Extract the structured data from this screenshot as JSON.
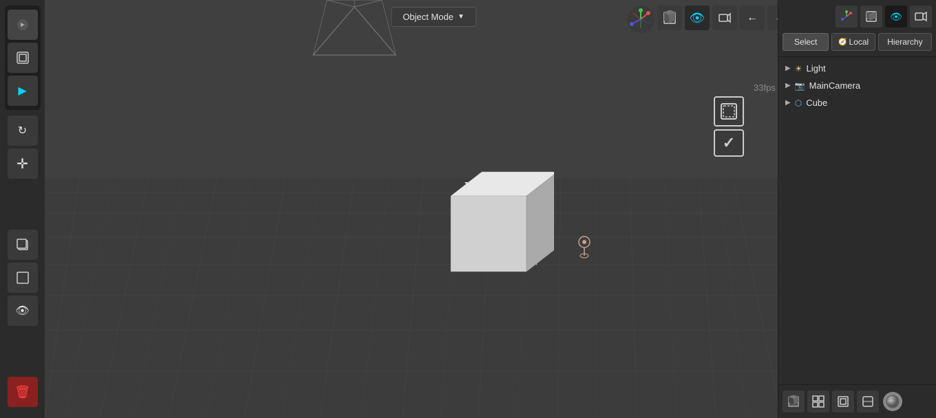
{
  "viewport": {
    "mode_label": "Object Mode",
    "fps": "33fps"
  },
  "top_toolbar": {
    "btn1_icon": "◻",
    "btn2_icon": "▷",
    "btn3_label": "↺"
  },
  "left_sidebar": {
    "move_icon": "✛",
    "copy_icon": "❐",
    "frame_icon": "▢",
    "eye_icon": "👁",
    "delete_icon": "🗑"
  },
  "right_panel": {
    "select_label": "Select",
    "local_label": "Local",
    "hierarchy_label": "Hierarchy",
    "items": [
      {
        "id": "light",
        "label": "Light",
        "icon": "▶",
        "type": "light"
      },
      {
        "id": "maincamera",
        "label": "MainCamera",
        "icon": "▶",
        "type": "camera"
      },
      {
        "id": "cube",
        "label": "Cube",
        "icon": "▶",
        "type": "cube"
      }
    ]
  },
  "bottom_toolbar": {
    "icon1": "◼",
    "icon2": "⊞",
    "icon3": "⬡",
    "icon4": "◻",
    "icon5": "●"
  },
  "gizmo": {
    "x_color": "#e05050",
    "y_color": "#50c050",
    "z_color": "#5050e0"
  }
}
